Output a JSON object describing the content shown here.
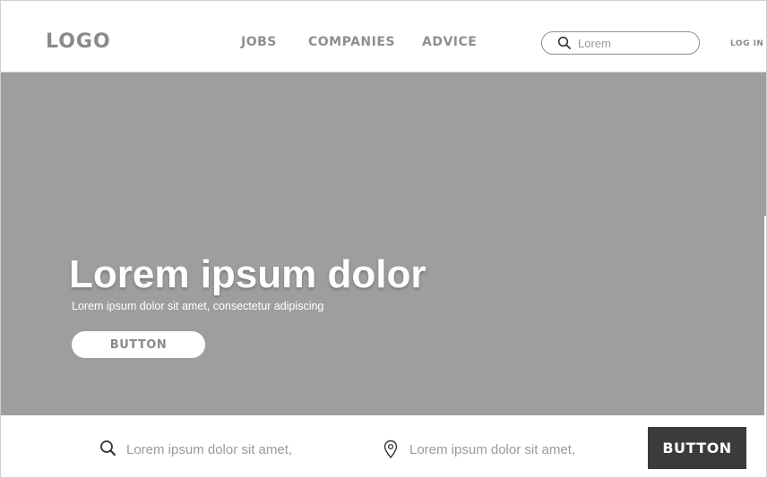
{
  "header": {
    "logo": "LOGO",
    "nav": [
      "JOBS",
      "COMPANIES",
      "ADVICE"
    ],
    "search": {
      "placeholder": "Lorem",
      "icon": "search-icon"
    },
    "login_label": "LOG IN"
  },
  "hero": {
    "title": "Lorem ipsum dolor",
    "subtitle": "Lorem ipsum dolor sit amet, consectetur adipiscing",
    "button_label": "BUTTON"
  },
  "search_bar": {
    "keyword_placeholder": "Lorem ipsum dolor sit amet,",
    "location_placeholder": "Lorem ipsum dolor sit amet,",
    "button_label": "BUTTON",
    "icons": [
      "search-icon",
      "map-pin-icon"
    ]
  },
  "colors": {
    "hero_bg": "#9e9e9e",
    "button_dark": "#3b3b3b",
    "text_grey": "#8a8a8a"
  }
}
